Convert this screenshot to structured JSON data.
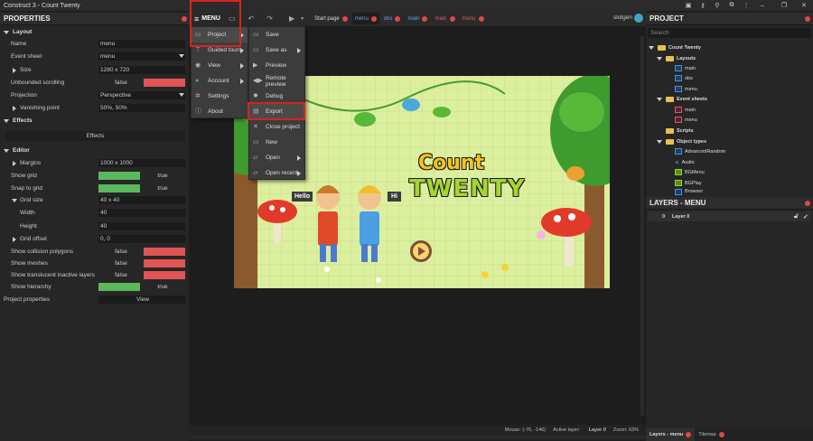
{
  "window": {
    "title": "Construct 3 - Count Twenty"
  },
  "properties": {
    "title": "PROPERTIES",
    "layout_section": "Layout",
    "rows": [
      {
        "key": "Name",
        "value": "menu"
      },
      {
        "key": "Event sheet",
        "value": "menu"
      },
      {
        "key": "Size",
        "value": "1280 x 720"
      },
      {
        "key": "Unbounded scrolling",
        "value": "false"
      },
      {
        "key": "Projection",
        "value": "Perspective"
      },
      {
        "key": "Vanishing point",
        "value": "50%, 50%"
      }
    ],
    "effects_section": "Effects",
    "effects_button": "Effects",
    "editor_section": "Editor",
    "editor_rows": [
      {
        "key": "Margins",
        "value": "1000 x 1000"
      },
      {
        "key": "Show grid",
        "value": "true"
      },
      {
        "key": "Snap to grid",
        "value": "true"
      },
      {
        "key": "Grid size",
        "value": "40 x 40"
      },
      {
        "key": "Width",
        "value": "40"
      },
      {
        "key": "Height",
        "value": "40"
      },
      {
        "key": "Grid offset",
        "value": "0, 0"
      },
      {
        "key": "Show collision polygons",
        "value": "false"
      },
      {
        "key": "Show meshes",
        "value": "false"
      },
      {
        "key": "Show translucent inactive layers",
        "value": "false"
      },
      {
        "key": "Show hierarchy",
        "value": "true"
      }
    ],
    "project_properties": {
      "key": "Project properties",
      "value": "View"
    }
  },
  "toolbar": {
    "menu_label": "MENU",
    "user": "slotgen",
    "tabs": [
      "Start page",
      "menu",
      "obs",
      "main",
      "main",
      "menu"
    ]
  },
  "main_menu": {
    "items": [
      {
        "label": "Project",
        "icon": "gamepad-icon"
      },
      {
        "label": "Guided tours",
        "icon": "tours-icon"
      },
      {
        "label": "View",
        "icon": "eye-icon"
      },
      {
        "label": "Account",
        "icon": "account-icon"
      },
      {
        "label": "Settings",
        "icon": "gear-icon"
      },
      {
        "label": "About",
        "icon": "info-icon"
      }
    ]
  },
  "project_menu": {
    "items": [
      {
        "label": "Save",
        "icon": "save-icon"
      },
      {
        "label": "Save as",
        "icon": "save-as-icon"
      },
      {
        "label": "Preview",
        "icon": "play-icon"
      },
      {
        "label": "Remote preview",
        "icon": "remote-preview-icon"
      },
      {
        "label": "Debug",
        "icon": "debug-icon"
      },
      {
        "label": "Export",
        "icon": "export-icon"
      },
      {
        "label": "Close project",
        "icon": "close-icon"
      },
      {
        "label": "New",
        "icon": "new-icon"
      },
      {
        "label": "Open",
        "icon": "folder-icon"
      },
      {
        "label": "Open recent",
        "icon": "folder-icon"
      }
    ]
  },
  "canvas": {
    "title_line1": "Count",
    "title_line2": "TWENTY",
    "bubble_hello": "Hello",
    "bubble_hi": "Hi"
  },
  "project": {
    "title": "PROJECT",
    "search_placeholder": "Search",
    "root": "Count Twenty",
    "layouts_label": "Layouts",
    "layouts": [
      "main",
      "obs",
      "menu"
    ],
    "eventsheets_label": "Event sheets",
    "eventsheets": [
      "main",
      "menu"
    ],
    "scripts_label": "Scripts",
    "objecttypes_label": "Object types",
    "objecttypes": [
      "AdvancedRandom",
      "Audio",
      "BGMenu",
      "BGPlay",
      "Browser"
    ]
  },
  "layers": {
    "title": "LAYERS - MENU",
    "row_index": "0",
    "row_name": "Layer 0"
  },
  "bottom_tabs": {
    "layers": "Layers - menu",
    "tilemap": "Tilemap"
  },
  "status": {
    "mouse": "Mouse: (-76, -146)",
    "active_layer_label": "Active layer:",
    "active_layer": "Layer 0",
    "zoom": "Zoom: 63%"
  }
}
